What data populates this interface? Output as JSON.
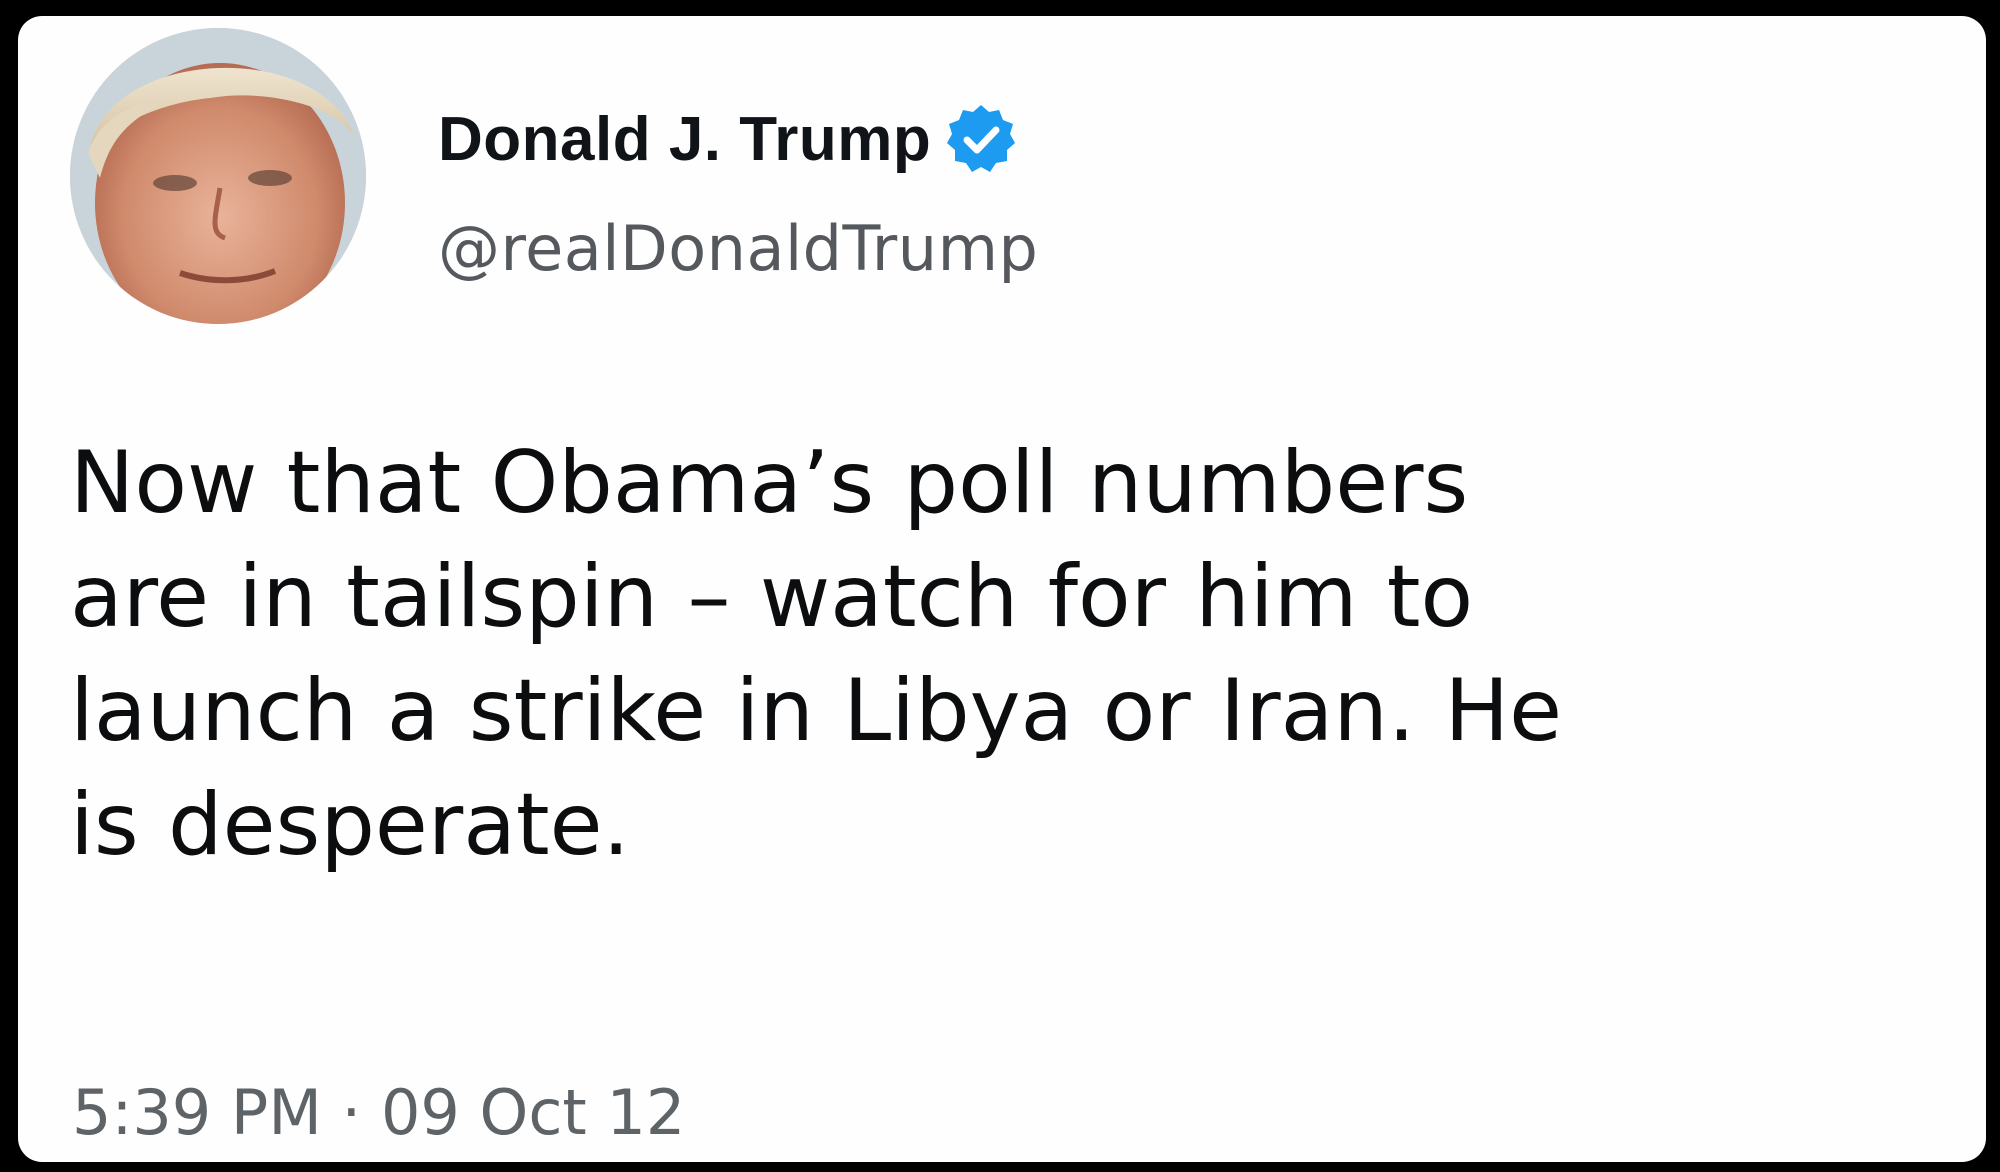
{
  "tweet": {
    "author": {
      "display_name": "Donald J. Trump",
      "handle": "@realDonaldTrump",
      "verified": true,
      "verified_icon": "verified-badge-icon",
      "avatar_icon": "profile-photo"
    },
    "text_lines": [
      "Now that Obama’s poll numbers",
      "are in tailspin – watch for him to",
      "launch a strike in Libya or Iran.  He",
      "is desperate."
    ],
    "timestamp": "5:39 PM · 09 Oct 12"
  },
  "colors": {
    "card_background": "#fefefe",
    "outer_background": "#000000",
    "verified_blue": "#1d9bf0",
    "name_text": "#101418",
    "handle_text": "#55595e",
    "body_text": "#0c0d0f",
    "timestamp_text": "#5e6367"
  }
}
